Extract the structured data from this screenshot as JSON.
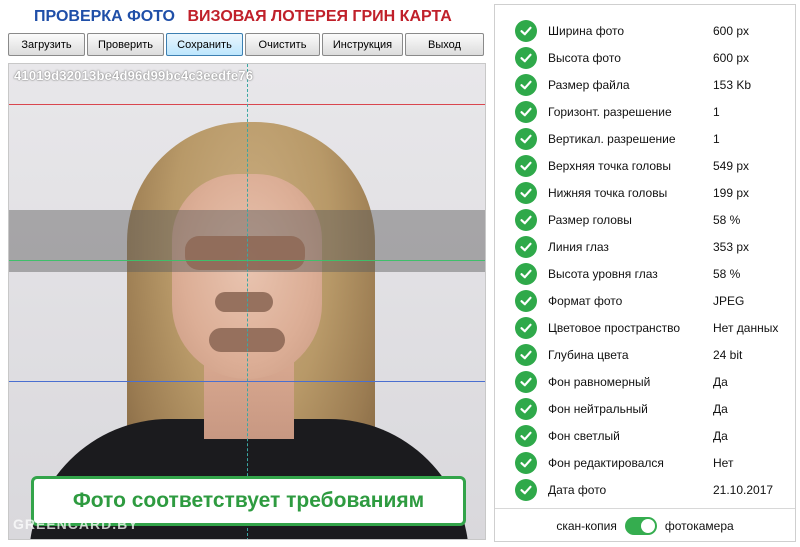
{
  "header": {
    "title_left": "ПРОВЕРКА ФОТО",
    "title_right": "ВИЗОВАЯ ЛОТЕРЕЯ ГРИН КАРТА"
  },
  "toolbar": {
    "buttons": [
      "Загрузить",
      "Проверить",
      "Сохранить",
      "Очистить",
      "Инструкция",
      "Выход"
    ],
    "active": "Сохранить"
  },
  "photo": {
    "id": "41019d32013be4d96d99bc4c3eedfe76",
    "verdict": "Фото соответствует требованиям",
    "watermark": "GREENCARD.BY"
  },
  "checks": [
    {
      "label": "Ширина фото",
      "value": "600 px"
    },
    {
      "label": "Высота фото",
      "value": "600 px"
    },
    {
      "label": "Размер файла",
      "value": "153 Kb"
    },
    {
      "label": "Горизонт. разрешение",
      "value": "1"
    },
    {
      "label": "Вертикал. разрешение",
      "value": "1"
    },
    {
      "label": "Верхняя точка головы",
      "value": "549 px"
    },
    {
      "label": "Нижняя точка головы",
      "value": "199 px"
    },
    {
      "label": "Размер головы",
      "value": "58 %"
    },
    {
      "label": "Линия глаз",
      "value": "353 px"
    },
    {
      "label": "Высота уровня глаз",
      "value": "58 %"
    },
    {
      "label": "Формат фото",
      "value": "JPEG"
    },
    {
      "label": "Цветовое пространство",
      "value": "Нет данных"
    },
    {
      "label": "Глубина цвета",
      "value": "24 bit"
    },
    {
      "label": "Фон равномерный",
      "value": "Да"
    },
    {
      "label": "Фон нейтральный",
      "value": "Да"
    },
    {
      "label": "Фон светлый",
      "value": "Да"
    },
    {
      "label": "Фон редактировался",
      "value": "Нет"
    },
    {
      "label": "Дата фото",
      "value": "21.10.2017"
    }
  ],
  "footer": {
    "left_label": "скан-копия",
    "right_label": "фотокамера",
    "toggle_on": true
  },
  "colors": {
    "check_green": "#2fa94a",
    "top_line": "#d9464f",
    "eye_line": "#3fbf6a",
    "chin_line": "#4a6fd0",
    "center_line": "#3aa7a3"
  }
}
